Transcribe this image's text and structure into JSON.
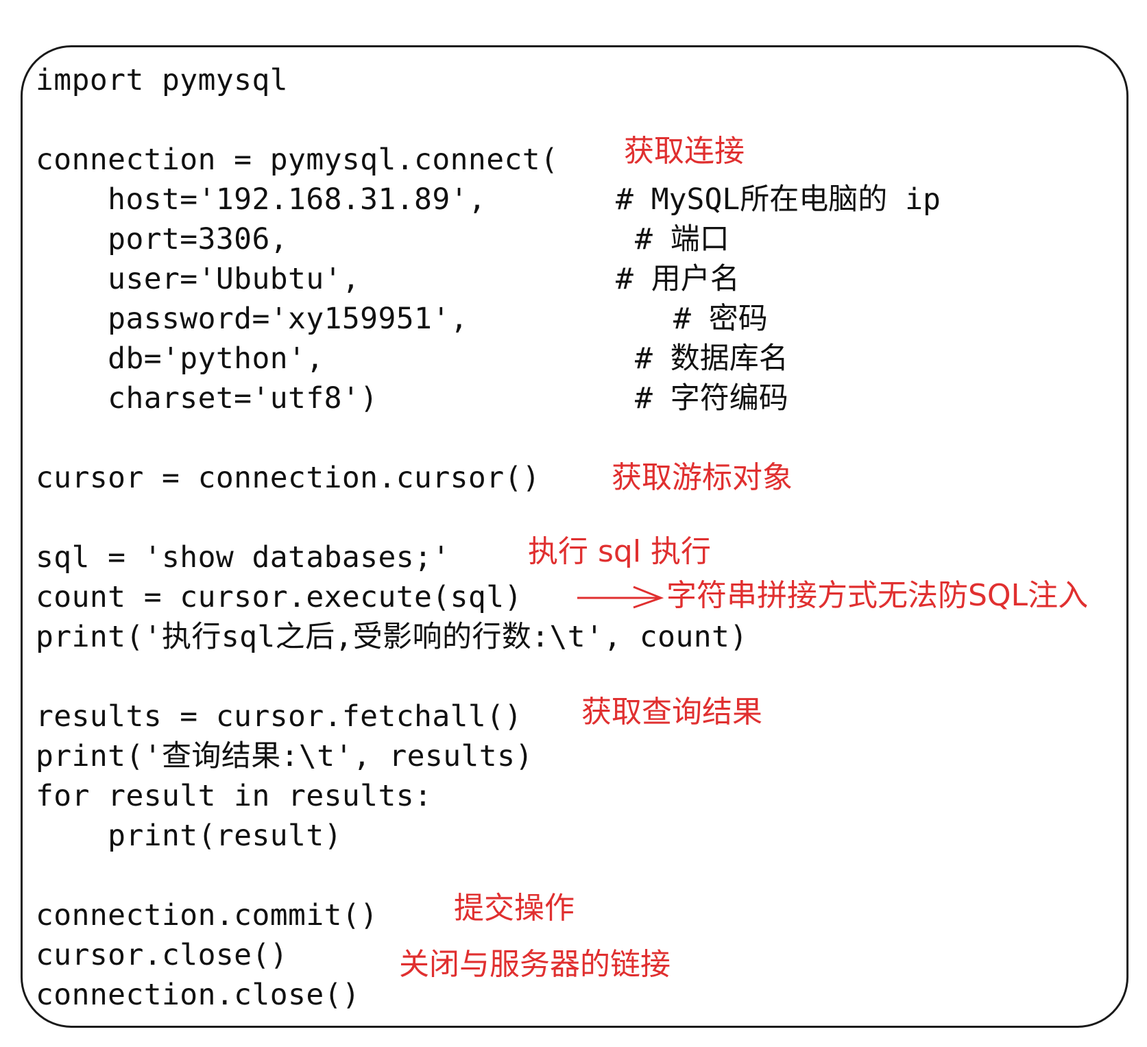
{
  "code": {
    "l01": "import pymysql",
    "l02": "connection = pymysql.connect(",
    "l03": "    host='192.168.31.89',",
    "l04": "    port=3306,",
    "l05": "    user='Ububtu',",
    "l06": "    password='xy159951',",
    "l07": "    db='python',",
    "l08": "    charset='utf8')",
    "l09": "cursor = connection.cursor()",
    "l10": "sql = 'show databases;'",
    "l11": "count = cursor.execute(sql)",
    "l12": "print('执行sql之后,受影响的行数:\\t', count)",
    "l13": "results = cursor.fetchall()",
    "l14": "print('查询结果:\\t', results)",
    "l15": "for result in results:",
    "l16": "    print(result)",
    "l17": "connection.commit()",
    "l18": "cursor.close()",
    "l19": "connection.close()"
  },
  "comments": {
    "host": "# MySQL所在电脑的 ip",
    "port": "# 端口",
    "user": "# 用户名",
    "password": "# 密码",
    "db": "# 数据库名",
    "charset": "# 字符编码"
  },
  "annotations": {
    "connect": "获取连接",
    "cursor": "获取游标对象",
    "sql": "执行 sql 执行",
    "execute": "字符串拼接方式无法防SQL注入",
    "fetchall": "获取查询结果",
    "commit": "提交操作",
    "close": "关闭与服务器的链接"
  },
  "colors": {
    "annotation": "#e03030",
    "code": "#111111",
    "frame": "#1a1a1a"
  }
}
